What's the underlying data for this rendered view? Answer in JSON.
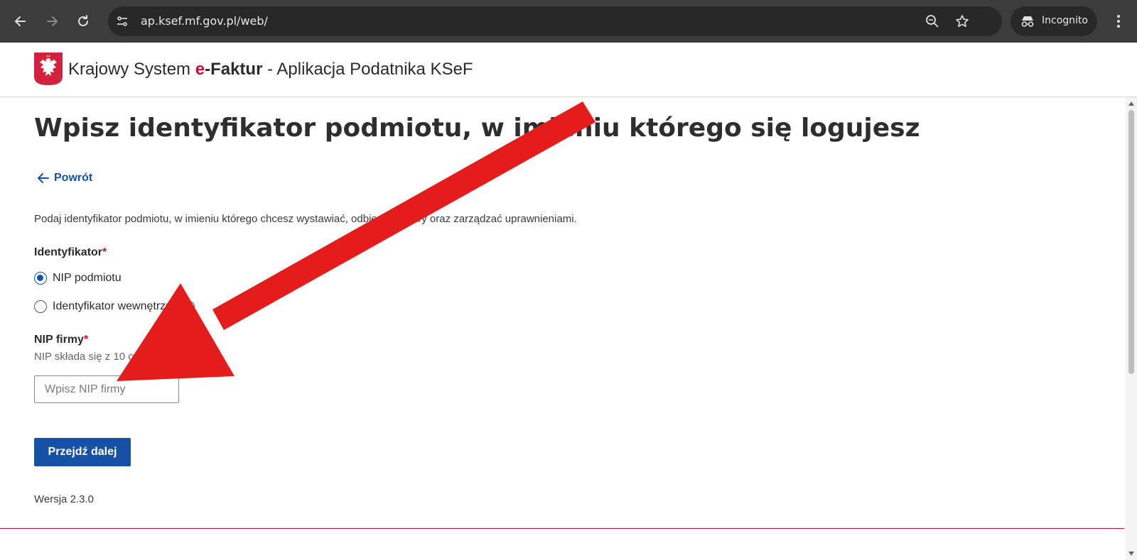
{
  "browser": {
    "url": "ap.ksef.mf.gov.pl/web/",
    "incognito_label": "Incognito",
    "icons": [
      "back-icon",
      "forward-icon",
      "reload-icon",
      "site-info-icon",
      "zoom-icon",
      "bookmark-star-icon",
      "incognito-icon",
      "more-menu-icon"
    ]
  },
  "header": {
    "brand_prefix": "Krajowy System ",
    "brand_e": "e",
    "brand_faktur": "-Faktur",
    "brand_suffix": " - Aplikacja Podatnika KSeF"
  },
  "page": {
    "title": "Wpisz identyfikator podmiotu, w imieniu którego się logujesz",
    "back_label": "Powrót",
    "description": "Podaj identyfikator podmiotu, w imieniu którego chcesz wystawiać, odbierać faktury oraz zarządzać uprawnieniami.",
    "identifier_label": "Identyfikator",
    "required_mark": "*",
    "radio_options": [
      {
        "label": "NIP podmiotu",
        "checked": true
      },
      {
        "label": "Identyfikator wewnętrzny",
        "checked": false
      }
    ],
    "info_glyph": "i",
    "nip_label": "NIP firmy",
    "nip_hint": "NIP składa się z 10 cyfr",
    "nip_placeholder": "Wpisz NIP firmy",
    "nip_value": "",
    "submit_label": "Przejdź dalej",
    "version": "Wersja 2.3.0"
  },
  "colors": {
    "accent_blue": "#1651a6",
    "brand_red": "#c8102e",
    "annotation_arrow": "#e41c1c"
  }
}
